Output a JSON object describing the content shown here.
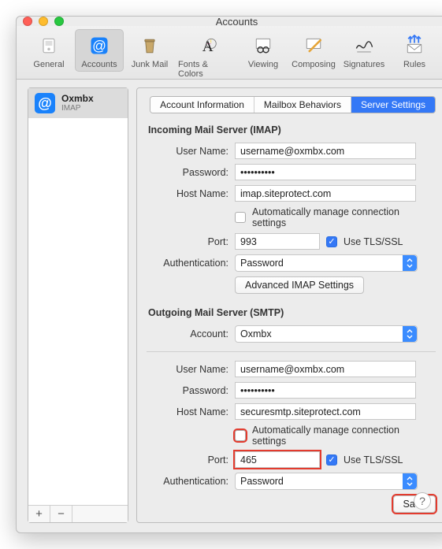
{
  "window": {
    "title": "Accounts"
  },
  "toolbar": {
    "items": [
      {
        "label": "General"
      },
      {
        "label": "Accounts"
      },
      {
        "label": "Junk Mail"
      },
      {
        "label": "Fonts & Colors"
      },
      {
        "label": "Viewing"
      },
      {
        "label": "Composing"
      },
      {
        "label": "Signatures"
      },
      {
        "label": "Rules"
      }
    ]
  },
  "sidebar": {
    "account": {
      "name": "Oxmbx",
      "protocol": "IMAP"
    },
    "add_label": "+",
    "remove_label": "−"
  },
  "tabs": {
    "info": "Account Information",
    "behaviors": "Mailbox Behaviors",
    "server": "Server Settings"
  },
  "incoming": {
    "heading": "Incoming Mail Server (IMAP)",
    "user_label": "User Name:",
    "user_value": "username@oxmbx.com",
    "pass_label": "Password:",
    "pass_value": "••••••••••",
    "host_label": "Host Name:",
    "host_value": "imap.siteprotect.com",
    "auto_label": "Automatically manage connection settings",
    "auto_checked": false,
    "port_label": "Port:",
    "port_value": "993",
    "tls_label": "Use TLS/SSL",
    "tls_checked": true,
    "auth_label": "Authentication:",
    "auth_value": "Password",
    "adv_label": "Advanced IMAP Settings"
  },
  "outgoing": {
    "heading": "Outgoing Mail Server (SMTP)",
    "acct_label": "Account:",
    "acct_value": "Oxmbx",
    "user_label": "User Name:",
    "user_value": "username@oxmbx.com",
    "pass_label": "Password:",
    "pass_value": "••••••••••",
    "host_label": "Host Name:",
    "host_value": "securesmtp.siteprotect.com",
    "auto_label": "Automatically manage connection settings",
    "auto_checked": false,
    "port_label": "Port:",
    "port_value": "465",
    "tls_label": "Use TLS/SSL",
    "tls_checked": true,
    "auth_label": "Authentication:",
    "auth_value": "Password"
  },
  "save_label": "Save",
  "help_label": "?"
}
